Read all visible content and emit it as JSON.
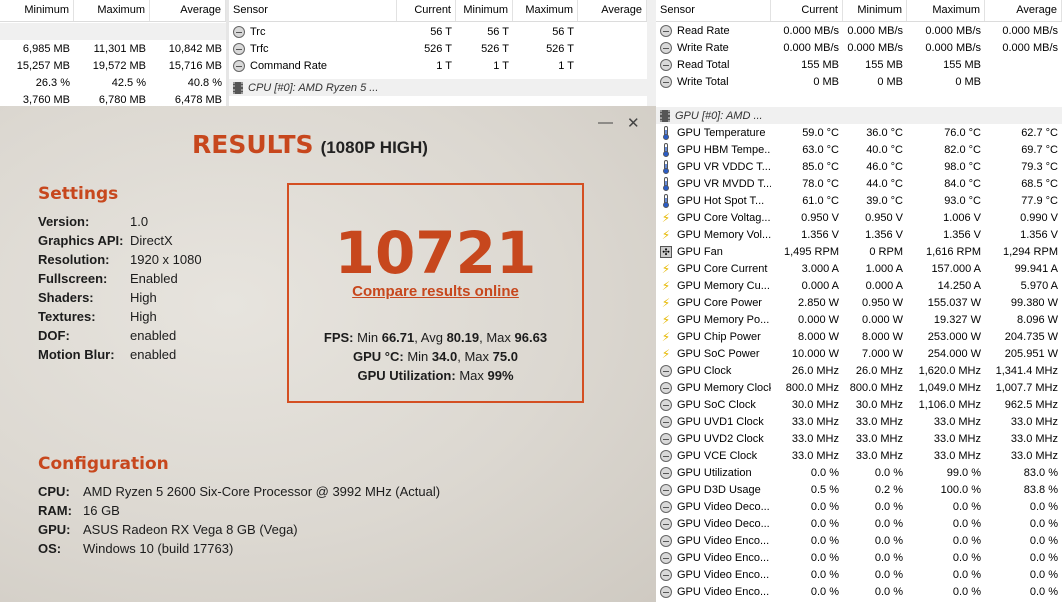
{
  "panel1": {
    "headers": [
      "Minimum",
      "Maximum",
      "Average"
    ],
    "rows": [
      [
        "",
        "",
        ""
      ],
      [
        "6,985 MB",
        "11,301 MB",
        "10,842 MB"
      ],
      [
        "15,257 MB",
        "19,572 MB",
        "15,716 MB"
      ],
      [
        "26.3 %",
        "42.5 %",
        "40.8 %"
      ],
      [
        "3,760 MB",
        "6,780 MB",
        "6,478 MB"
      ]
    ]
  },
  "panel2": {
    "headers": [
      "Sensor",
      "Current",
      "Minimum",
      "Maximum",
      "Average"
    ],
    "rows": [
      [
        "Trc",
        "56 T",
        "56 T",
        "56 T",
        ""
      ],
      [
        "Trfc",
        "526 T",
        "526 T",
        "526 T",
        ""
      ],
      [
        "Command Rate",
        "1 T",
        "1 T",
        "1 T",
        ""
      ]
    ],
    "group": "CPU [#0]: AMD Ryzen 5 ..."
  },
  "panel3": {
    "headers": [
      "Sensor",
      "Current",
      "Minimum",
      "Maximum",
      "Average"
    ],
    "top_rows": [
      {
        "icon": "clock-icon",
        "cells": [
          "Read Rate",
          "0.000 MB/s",
          "0.000 MB/s",
          "0.000 MB/s",
          "0.000 MB/s"
        ]
      },
      {
        "icon": "clock-icon",
        "cells": [
          "Write Rate",
          "0.000 MB/s",
          "0.000 MB/s",
          "0.000 MB/s",
          "0.000 MB/s"
        ]
      },
      {
        "icon": "clock-icon",
        "cells": [
          "Read Total",
          "155 MB",
          "155 MB",
          "155 MB",
          ""
        ]
      },
      {
        "icon": "clock-icon",
        "cells": [
          "Write Total",
          "0 MB",
          "0 MB",
          "0 MB",
          ""
        ]
      }
    ],
    "group": "GPU [#0]: AMD ...",
    "gpu_rows": [
      {
        "icon": "thermometer-icon",
        "cells": [
          "GPU Temperature",
          "59.0 °C",
          "36.0 °C",
          "76.0 °C",
          "62.7 °C"
        ]
      },
      {
        "icon": "thermometer-icon",
        "cells": [
          "GPU HBM Tempe...",
          "63.0 °C",
          "40.0 °C",
          "82.0 °C",
          "69.7 °C"
        ]
      },
      {
        "icon": "thermometer-icon",
        "cells": [
          "GPU VR VDDC T...",
          "85.0 °C",
          "46.0 °C",
          "98.0 °C",
          "79.3 °C"
        ]
      },
      {
        "icon": "thermometer-icon",
        "cells": [
          "GPU VR MVDD T...",
          "78.0 °C",
          "44.0 °C",
          "84.0 °C",
          "68.5 °C"
        ]
      },
      {
        "icon": "thermometer-icon",
        "cells": [
          "GPU Hot Spot T...",
          "61.0 °C",
          "39.0 °C",
          "93.0 °C",
          "77.9 °C"
        ]
      },
      {
        "icon": "voltage-icon",
        "cells": [
          "GPU Core Voltag...",
          "0.950 V",
          "0.950 V",
          "1.006 V",
          "0.990 V"
        ]
      },
      {
        "icon": "voltage-icon",
        "cells": [
          "GPU Memory Vol...",
          "1.356 V",
          "1.356 V",
          "1.356 V",
          "1.356 V"
        ]
      },
      {
        "icon": "fan-icon",
        "cells": [
          "GPU Fan",
          "1,495 RPM",
          "0 RPM",
          "1,616 RPM",
          "1,294 RPM"
        ]
      },
      {
        "icon": "voltage-icon",
        "cells": [
          "GPU Core Current",
          "3.000 A",
          "1.000 A",
          "157.000 A",
          "99.941 A"
        ]
      },
      {
        "icon": "voltage-icon",
        "cells": [
          "GPU Memory Cu...",
          "0.000 A",
          "0.000 A",
          "14.250 A",
          "5.970 A"
        ]
      },
      {
        "icon": "voltage-icon",
        "cells": [
          "GPU Core Power",
          "2.850 W",
          "0.950 W",
          "155.037 W",
          "99.380 W"
        ]
      },
      {
        "icon": "voltage-icon",
        "cells": [
          "GPU Memory Po...",
          "0.000 W",
          "0.000 W",
          "19.327 W",
          "8.096 W"
        ]
      },
      {
        "icon": "voltage-icon",
        "cells": [
          "GPU Chip Power",
          "8.000 W",
          "8.000 W",
          "253.000 W",
          "204.735 W"
        ]
      },
      {
        "icon": "voltage-icon",
        "cells": [
          "GPU SoC Power",
          "10.000 W",
          "7.000 W",
          "254.000 W",
          "205.951 W"
        ]
      },
      {
        "icon": "clock-icon",
        "cells": [
          "GPU Clock",
          "26.0 MHz",
          "26.0 MHz",
          "1,620.0 MHz",
          "1,341.4 MHz"
        ]
      },
      {
        "icon": "clock-icon",
        "cells": [
          "GPU Memory Clock",
          "800.0 MHz",
          "800.0 MHz",
          "1,049.0 MHz",
          "1,007.7 MHz"
        ]
      },
      {
        "icon": "clock-icon",
        "cells": [
          "GPU SoC Clock",
          "30.0 MHz",
          "30.0 MHz",
          "1,106.0 MHz",
          "962.5 MHz"
        ]
      },
      {
        "icon": "clock-icon",
        "cells": [
          "GPU UVD1 Clock",
          "33.0 MHz",
          "33.0 MHz",
          "33.0 MHz",
          "33.0 MHz"
        ]
      },
      {
        "icon": "clock-icon",
        "cells": [
          "GPU UVD2 Clock",
          "33.0 MHz",
          "33.0 MHz",
          "33.0 MHz",
          "33.0 MHz"
        ]
      },
      {
        "icon": "clock-icon",
        "cells": [
          "GPU VCE Clock",
          "33.0 MHz",
          "33.0 MHz",
          "33.0 MHz",
          "33.0 MHz"
        ]
      },
      {
        "icon": "clock-icon",
        "cells": [
          "GPU Utilization",
          "0.0 %",
          "0.0 %",
          "99.0 %",
          "83.0 %"
        ]
      },
      {
        "icon": "clock-icon",
        "cells": [
          "GPU D3D Usage",
          "0.5 %",
          "0.2 %",
          "100.0 %",
          "83.8 %"
        ]
      },
      {
        "icon": "clock-icon",
        "cells": [
          "GPU Video Deco...",
          "0.0 %",
          "0.0 %",
          "0.0 %",
          "0.0 %"
        ]
      },
      {
        "icon": "clock-icon",
        "cells": [
          "GPU Video Deco...",
          "0.0 %",
          "0.0 %",
          "0.0 %",
          "0.0 %"
        ]
      },
      {
        "icon": "clock-icon",
        "cells": [
          "GPU Video Enco...",
          "0.0 %",
          "0.0 %",
          "0.0 %",
          "0.0 %"
        ]
      },
      {
        "icon": "clock-icon",
        "cells": [
          "GPU Video Enco...",
          "0.0 %",
          "0.0 %",
          "0.0 %",
          "0.0 %"
        ]
      },
      {
        "icon": "clock-icon",
        "cells": [
          "GPU Video Enco...",
          "0.0 %",
          "0.0 %",
          "0.0 %",
          "0.0 %"
        ]
      },
      {
        "icon": "clock-icon",
        "cells": [
          "GPU Video Enco...",
          "0.0 %",
          "0.0 %",
          "0.0 %",
          "0.0 %"
        ]
      }
    ]
  },
  "results": {
    "title": "RESULTS",
    "subtitle": "(1080P HIGH)",
    "minimize_glyph": "—",
    "close_glyph": "✕",
    "settings_heading": "Settings",
    "settings": [
      {
        "k": "Version:",
        "v": "1.0"
      },
      {
        "k": "Graphics API:",
        "v": "DirectX"
      },
      {
        "k": "Resolution:",
        "v": "1920 x 1080"
      },
      {
        "k": "Fullscreen:",
        "v": "Enabled"
      },
      {
        "k": "Shaders:",
        "v": "High"
      },
      {
        "k": "Textures:",
        "v": "High"
      },
      {
        "k": "DOF:",
        "v": "enabled"
      },
      {
        "k": "Motion Blur:",
        "v": "enabled"
      }
    ],
    "score": "10721",
    "compare_label": "Compare results online",
    "fps_label": "FPS:",
    "fps_min_label": "Min",
    "fps_min": "66.71",
    "fps_avg_label": ", Avg",
    "fps_avg": "80.19",
    "fps_max_label": ", Max",
    "fps_max": "96.63",
    "gpu_temp_label": "GPU °C:",
    "gpu_temp_min_label": "Min",
    "gpu_temp_min": "34.0",
    "gpu_temp_max_label": ", Max",
    "gpu_temp_max": "75.0",
    "gpu_util_label": "GPU Utilization:",
    "gpu_util_max_label": "Max",
    "gpu_util_max": "99%",
    "config_heading": "Configuration",
    "config": [
      {
        "k": "CPU:",
        "v": "AMD Ryzen 5 2600 Six-Core Processor @ 3992 MHz (Actual)"
      },
      {
        "k": "RAM:",
        "v": "16 GB"
      },
      {
        "k": "GPU:",
        "v": "ASUS Radeon RX Vega 8 GB (Vega)"
      },
      {
        "k": "OS:",
        "v": "Windows 10 (build 17763)"
      }
    ],
    "accent_color": "#c7471d"
  }
}
